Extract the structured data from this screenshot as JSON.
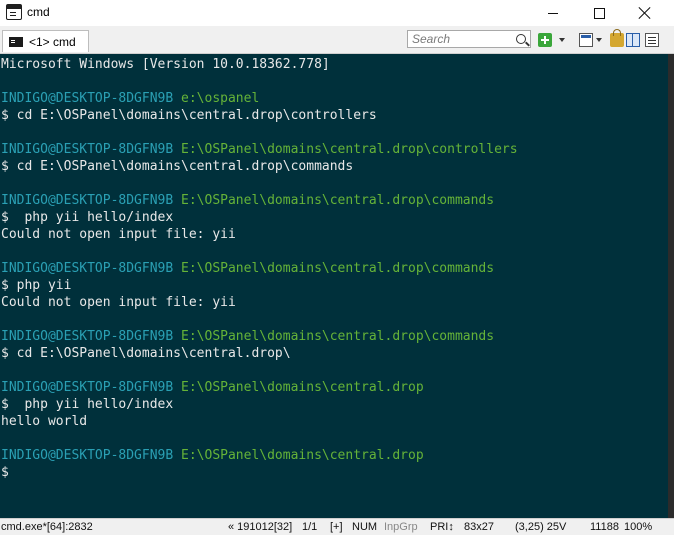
{
  "window": {
    "title": "cmd"
  },
  "tab": {
    "label": "<1> cmd"
  },
  "toolbar": {
    "search_placeholder": "Search"
  },
  "console": {
    "header": "Microsoft Windows [Version 10.0.18362.778]",
    "lines": [
      {
        "user": "INDIGO@DESKTOP-8DGFN9B",
        "path": "e:\\ospanel"
      },
      {
        "cmd": "$ cd E:\\OSPanel\\domains\\central.drop\\controllers"
      },
      {
        "user": "INDIGO@DESKTOP-8DGFN9B",
        "path": "E:\\OSPanel\\domains\\central.drop\\controllers"
      },
      {
        "cmd": "$ cd E:\\OSPanel\\domains\\central.drop\\commands"
      },
      {
        "user": "INDIGO@DESKTOP-8DGFN9B",
        "path": "E:\\OSPanel\\domains\\central.drop\\commands"
      },
      {
        "cmd": "$  php yii hello/index"
      },
      {
        "out": "Could not open input file: yii"
      },
      {
        "user": "INDIGO@DESKTOP-8DGFN9B",
        "path": "E:\\OSPanel\\domains\\central.drop\\commands"
      },
      {
        "cmd": "$ php yii"
      },
      {
        "out": "Could not open input file: yii"
      },
      {
        "user": "INDIGO@DESKTOP-8DGFN9B",
        "path": "E:\\OSPanel\\domains\\central.drop\\commands"
      },
      {
        "cmd": "$ cd E:\\OSPanel\\domains\\central.drop\\"
      },
      {
        "user": "INDIGO@DESKTOP-8DGFN9B",
        "path": "E:\\OSPanel\\domains\\central.drop"
      },
      {
        "cmd": "$  php yii hello/index"
      },
      {
        "out": "hello world"
      },
      {
        "user": "INDIGO@DESKTOP-8DGFN9B",
        "path": "E:\\OSPanel\\domains\\central.drop"
      },
      {
        "cmd": "$"
      }
    ]
  },
  "statusbar": {
    "process": "cmd.exe*[64]:2832",
    "position": "« 191012[32]",
    "page": "1/1",
    "plus": "[+]",
    "num": "NUM",
    "inpgrp": "InpGrp",
    "pri": "PRI↕",
    "size": "83x27",
    "cursor": "(3,25) 25V",
    "pid": "11188",
    "zoom": "100%"
  },
  "colors": {
    "console_bg": "#00303b",
    "prompt_user": "#2aa0b4",
    "prompt_path": "#65b338",
    "text": "#e8e8e8"
  }
}
